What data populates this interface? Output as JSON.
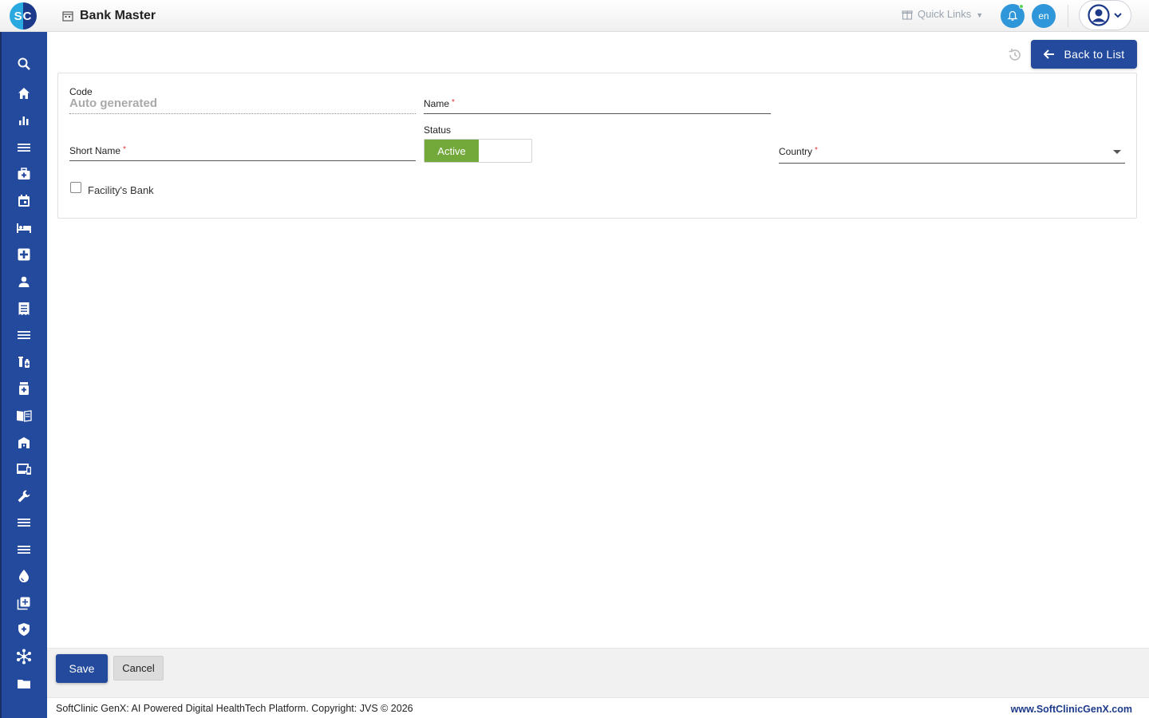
{
  "header": {
    "logo_text": "SC",
    "page_title": "Bank Master",
    "quick_links_label": "Quick Links",
    "language": "en"
  },
  "toolbar": {
    "back_label": "Back to List"
  },
  "form": {
    "code_label": "Code",
    "code_value": "Auto generated",
    "name_label": "Name",
    "short_name_label": "Short Name",
    "status_label": "Status",
    "status_value": "Active",
    "country_label": "Country",
    "required_mark": "*",
    "facility_bank_label": "Facility's Bank",
    "facility_bank_checked": false
  },
  "actions": {
    "save_label": "Save",
    "cancel_label": "Cancel"
  },
  "footer": {
    "copyright": "SoftClinic GenX: AI Powered Digital HealthTech Platform. Copyright: JVS © 2026",
    "website": "www.SoftClinicGenX.com"
  },
  "sidebar": {
    "icons": [
      "search-icon",
      "home-icon",
      "bar-chart-icon",
      "menu-icon",
      "medical-bag-icon",
      "calendar-icon",
      "bed-icon",
      "medical-cross-icon",
      "person-icon",
      "receipt-icon",
      "menu-icon",
      "pharmacy-icon",
      "medicine-bottle-icon",
      "book-icon",
      "store-icon",
      "devices-icon",
      "wrench-icon",
      "menu-icon",
      "menu-icon",
      "blood-drop-icon",
      "add-box-icon",
      "shield-icon",
      "network-icon",
      "folder-icon"
    ]
  },
  "colors": {
    "primary": "#234a9c",
    "accent": "#2f97d9",
    "status_active": "#72a93a",
    "required": "#dd3333"
  }
}
